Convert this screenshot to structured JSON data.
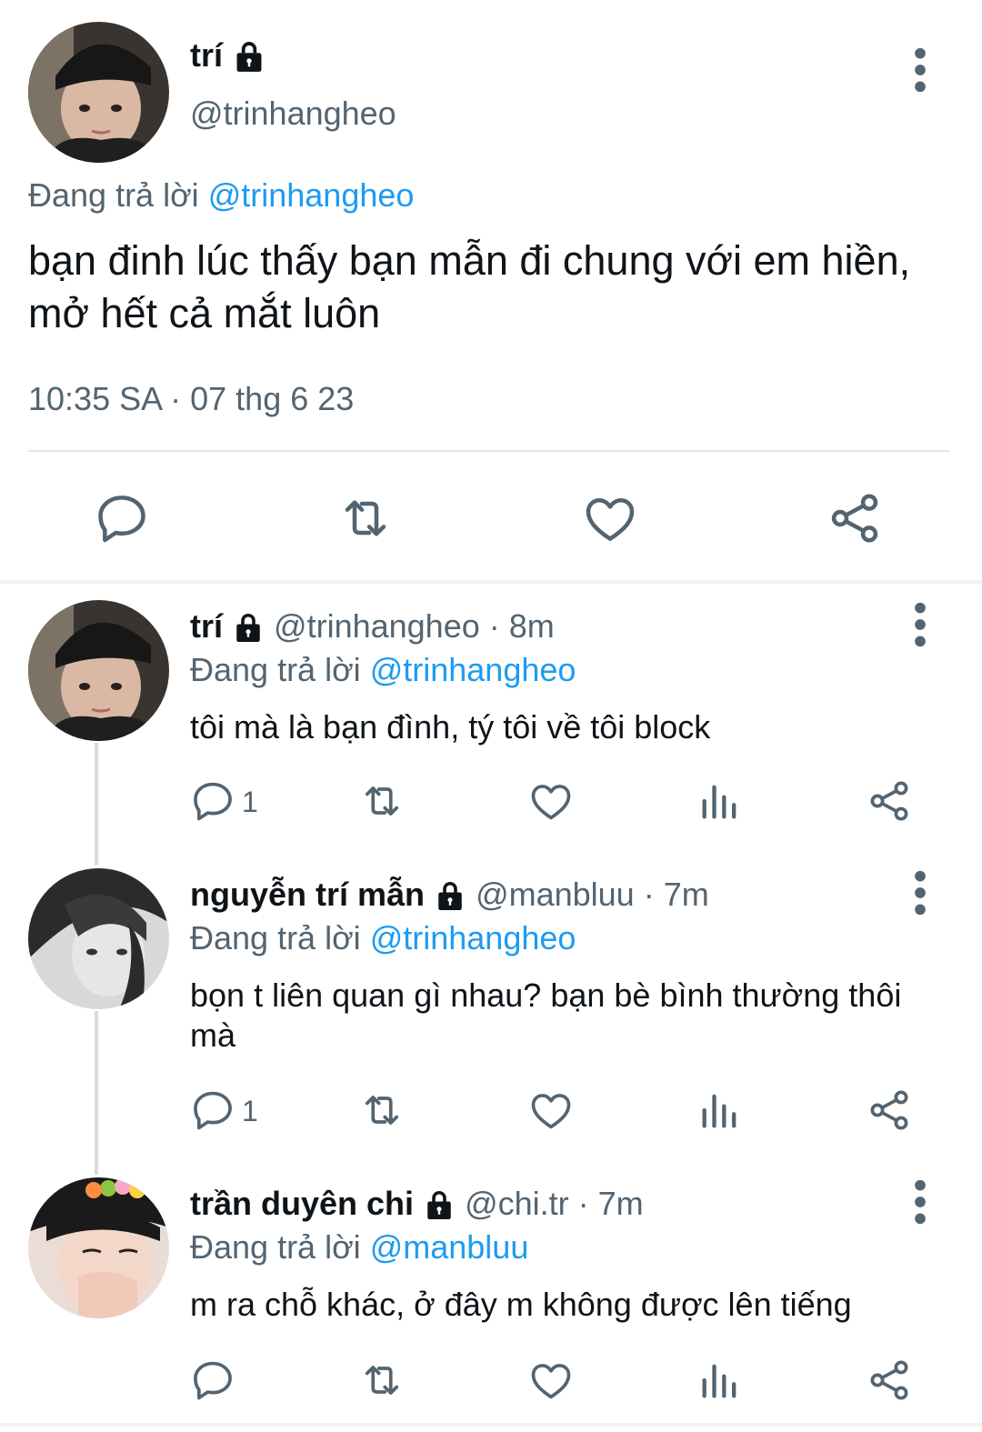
{
  "main_tweet": {
    "name": "trí",
    "handle": "@trinhangheo",
    "replying_label": "Đang trả lời",
    "replying_to": "@trinhangheo",
    "text": "bạn đinh lúc thấy bạn mẫn đi chung với em hiền, mở hết cả mắt luôn",
    "timestamp": "10:35 SA · 07 thg 6 23",
    "actions": [
      "reply-icon",
      "retweet-icon",
      "like-icon",
      "share-icon"
    ]
  },
  "replies": [
    {
      "name": "trí",
      "handle_time": "@trinhangheo · 8m",
      "replying_label": "Đang trả lời",
      "replying_to": "@trinhangheo",
      "text": "tôi mà là bạn đình, tý tôi về tôi block",
      "reply_count": "1"
    },
    {
      "name": "nguyễn trí mẫn",
      "handle_time": "@manbluu · 7m",
      "replying_label": "Đang trả lời",
      "replying_to": "@trinhangheo",
      "text": "bọn t liên quan gì nhau? bạn bè bình thường thôi mà",
      "reply_count": "1"
    },
    {
      "name": "trần duyên chi",
      "handle_time": "@chi.tr · 7m",
      "replying_label": "Đang trả lời",
      "replying_to": "@manbluu",
      "text": "m ra chỗ khác, ở đây m không được lên tiếng",
      "reply_count": ""
    }
  ],
  "colors": {
    "accent": "#1d9bf0",
    "secondary_text": "#536471",
    "primary_text": "#0f1419",
    "icon": "#536471"
  }
}
